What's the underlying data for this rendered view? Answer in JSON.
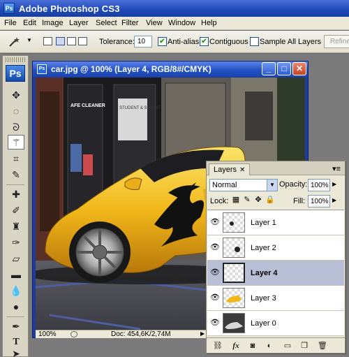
{
  "app": {
    "title": "Adobe Photoshop CS3",
    "icon": "Ps"
  },
  "menu": [
    "File",
    "Edit",
    "Image",
    "Layer",
    "Select",
    "Filter",
    "View",
    "Window",
    "Help"
  ],
  "options": {
    "tolerance_label": "Tolerance:",
    "tolerance_value": "10",
    "anti_alias_label": "Anti-alias",
    "anti_alias_checked": true,
    "contiguous_label": "Contiguous",
    "contiguous_checked": true,
    "sample_all_label": "Sample All Layers",
    "sample_all_checked": false,
    "refine_label": "Refine"
  },
  "toolbox": {
    "logo": "Ps",
    "tools": [
      "move-tool",
      "marquee-tool",
      "lasso-tool",
      "magic-wand-tool",
      "crop-tool",
      "eyedropper-tool",
      "healing-brush-tool",
      "brush-tool",
      "clone-stamp-tool",
      "history-brush-tool",
      "eraser-tool",
      "gradient-tool",
      "blur-tool",
      "dodge-tool",
      "pen-tool",
      "type-tool",
      "path-selection-tool",
      "rectangle-tool"
    ],
    "active_tool": "magic-wand-tool"
  },
  "document": {
    "title": "car.jpg @ 100% (Layer 4, RGB/8#/CMYK)",
    "icon": "Ps",
    "zoom": "100%",
    "doc_info": "Doc: 454,6K/2,74M",
    "window_buttons": [
      "_",
      "□",
      "✕"
    ],
    "shop_sign_1": "AFE CLEANER",
    "shop_sign_2": "STUDENT & SENIOR DISCOUNT"
  },
  "layers_panel": {
    "tab": "Layers",
    "tab_close": "✕",
    "blend_mode": "Normal",
    "opacity_label": "Opacity:",
    "opacity": "100%",
    "lock_label": "Lock:",
    "fill_label": "Fill:",
    "fill": "100%",
    "layers": [
      {
        "name": "Layer 1",
        "selected": false
      },
      {
        "name": "Layer 2",
        "selected": false
      },
      {
        "name": "Layer 4",
        "selected": true
      },
      {
        "name": "Layer 3",
        "selected": false
      },
      {
        "name": "Layer 0",
        "selected": false
      }
    ]
  },
  "colors": {
    "accent": "#1f48b8",
    "car_yellow": "#f2b81a",
    "selected_layer": "#b8bfd6"
  }
}
